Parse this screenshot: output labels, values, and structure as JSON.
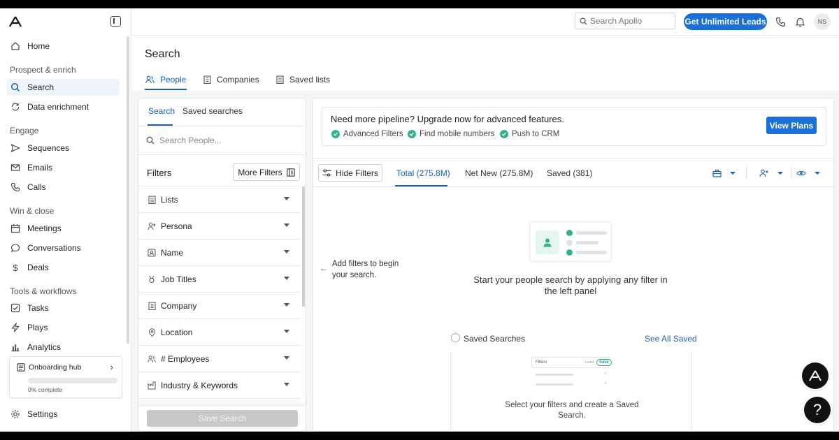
{
  "sidebar": {
    "home": "Home",
    "sections": {
      "prospect": "Prospect & enrich",
      "engage": "Engage",
      "win": "Win & close",
      "tools": "Tools & workflows"
    },
    "items": {
      "search": "Search",
      "data_enrichment": "Data enrichment",
      "sequences": "Sequences",
      "emails": "Emails",
      "calls": "Calls",
      "meetings": "Meetings",
      "conversations": "Conversations",
      "deals": "Deals",
      "tasks": "Tasks",
      "plays": "Plays",
      "analytics": "Analytics"
    },
    "onboarding": {
      "title": "Onboarding hub",
      "progress_text": "0% complete",
      "progress": 0
    },
    "settings": "Settings"
  },
  "topbar": {
    "search_placeholder": "Search Apollo",
    "cta": "Get Unlimited Leads",
    "avatar_initials": "NS"
  },
  "page": {
    "title": "Search",
    "tabs": [
      "People",
      "Companies",
      "Saved lists"
    ]
  },
  "filter_panel": {
    "tabs": [
      "Search",
      "Saved searches"
    ],
    "search_placeholder": "Search People...",
    "filters_title": "Filters",
    "more_filters": "More Filters",
    "filters": [
      "Lists",
      "Persona",
      "Name",
      "Job Titles",
      "Company",
      "Location",
      "# Employees",
      "Industry & Keywords"
    ],
    "save_search": "Save Search"
  },
  "results": {
    "upsell": {
      "title": "Need more pipeline? Upgrade now for advanced features.",
      "features": [
        "Advanced Filters",
        "Find mobile numbers",
        "Push to CRM"
      ],
      "button": "View Plans"
    },
    "hide_filters": "Hide Filters",
    "tabs": [
      "Total (275.8M)",
      "Net New (275.8M)",
      "Saved (381)"
    ],
    "hint": "Add filters to begin your search.",
    "empty_title": "Start your people search by applying any filter in the left panel",
    "saved_searches": {
      "title": "Saved Searches",
      "see_all": "See All Saved",
      "mini_filters": "Filters",
      "mini_load": "Load",
      "mini_save": "Save",
      "text": "Select your filters and create a Saved Search."
    }
  },
  "colors": {
    "accent": "#1a6fd8",
    "success": "#2fb67c",
    "link": "#1a5fb4"
  }
}
